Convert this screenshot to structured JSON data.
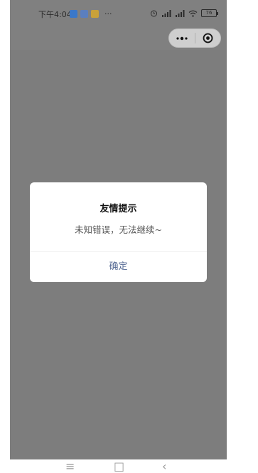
{
  "status_bar": {
    "time": "下午4:04",
    "more": "···",
    "battery": "76"
  },
  "capsule": {
    "menu_icon": "more-dots-icon",
    "close_icon": "target-close-icon"
  },
  "dialog": {
    "title": "友情提示",
    "message": "未知错误，无法继续~",
    "confirm_label": "确定"
  },
  "system_nav": {
    "menu_glyph": "≡",
    "home_glyph": "□",
    "back_glyph": "‹"
  },
  "colors": {
    "overlay": "#7d7d7d",
    "confirm_text": "#576b95"
  }
}
